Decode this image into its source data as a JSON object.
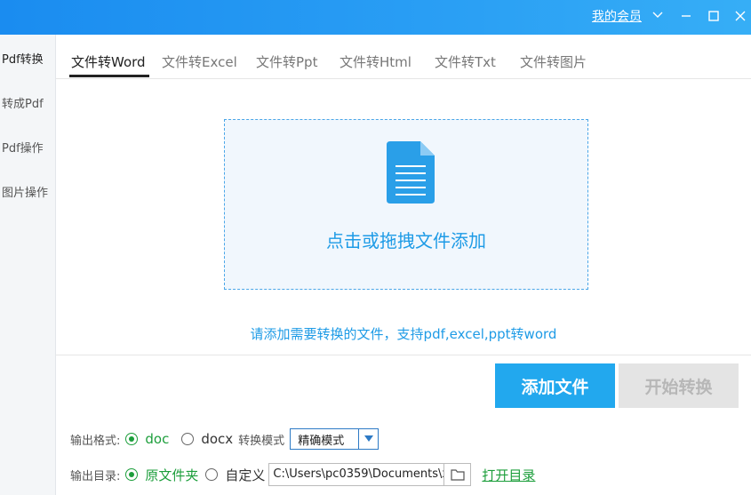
{
  "titlebar": {
    "member_link": "我的会员",
    "icons": [
      "chevron-down-icon",
      "minimize-icon",
      "maximize-icon",
      "close-icon"
    ]
  },
  "sidebar": {
    "items": [
      {
        "label": "Pdf转换",
        "active": true
      },
      {
        "label": "转成Pdf"
      },
      {
        "label": "Pdf操作"
      },
      {
        "label": "图片操作"
      }
    ]
  },
  "tabs": [
    {
      "label": "文件转Word",
      "active": true
    },
    {
      "label": "文件转Excel"
    },
    {
      "label": "文件转Ppt"
    },
    {
      "label": "文件转Html"
    },
    {
      "label": "文件转Txt"
    },
    {
      "label": "文件转图片"
    }
  ],
  "dropzone": {
    "icon": "document-icon",
    "label": "点击或拖拽文件添加"
  },
  "hint": "请添加需要转换的文件，支持pdf,excel,ppt转word",
  "buttons": {
    "add": "添加文件",
    "start": "开始转换"
  },
  "output_format": {
    "label": "输出格式:",
    "options": [
      "doc",
      "docx"
    ],
    "selected": "doc",
    "mode_label": "转换模式",
    "mode_value": "精确模式"
  },
  "output_dir": {
    "label": "输出目录:",
    "options": [
      "原文件夹",
      "自定义"
    ],
    "selected": "原文件夹",
    "path": "C:\\Users\\pc0359\\Documents\\x",
    "open_link": "打开目录"
  },
  "colors": {
    "accent": "#22a8ee",
    "title_bar": "#1a8cf0",
    "green": "#1c9e3b",
    "disabled": "#e4e4e4"
  }
}
